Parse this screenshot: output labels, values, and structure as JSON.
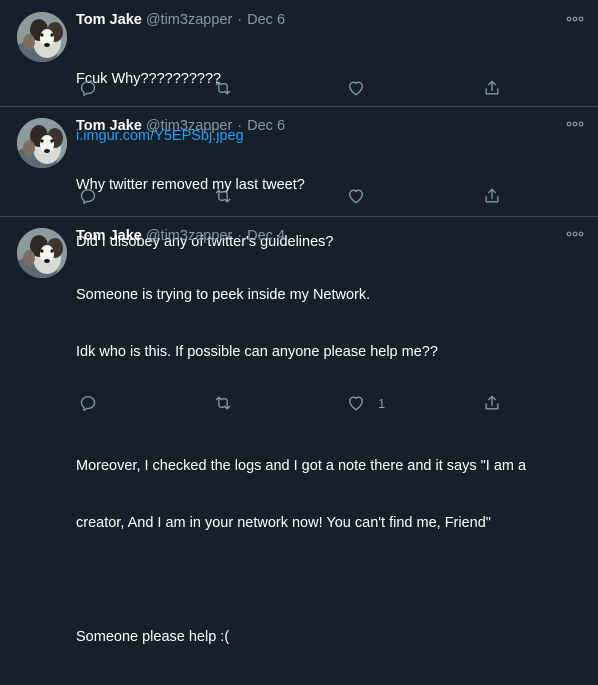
{
  "tweets": [
    {
      "display_name": "Tom Jake",
      "handle": "@tim3zapper",
      "separator": "·",
      "date": "Dec 6",
      "lines": [
        "Fcuk Why??????????"
      ],
      "link": "i.imgur.com/Y5EPSbj.jpeg",
      "like_count": ""
    },
    {
      "display_name": "Tom Jake",
      "handle": "@tim3zapper",
      "separator": "·",
      "date": "Dec 6",
      "lines": [
        "Why twitter removed my last tweet?",
        "Did I disobey any of twitter's guidelines?"
      ],
      "like_count": ""
    },
    {
      "display_name": "Tom Jake",
      "handle": "@tim3zapper",
      "separator": "·",
      "date": "Dec 4",
      "lines": [
        "Someone is trying to peek inside my Network.",
        "Idk who is this. If possible can anyone please help me??",
        "",
        "Moreover, I checked the logs and I got a note there and it says \"I am a",
        "creator, And I am in your network now! You can't find me, Friend\"",
        "",
        "Someone please help :("
      ],
      "like_count": "1"
    }
  ],
  "icons": {
    "reply": "reply-icon",
    "retweet": "retweet-icon",
    "like": "like-icon",
    "share": "share-icon",
    "more": "more-options-icon"
  },
  "colors": {
    "background": "#15202b",
    "divider": "#38444d",
    "secondary_text": "#8899a6",
    "link": "#1da1f2",
    "primary_text": "#ffffff"
  }
}
